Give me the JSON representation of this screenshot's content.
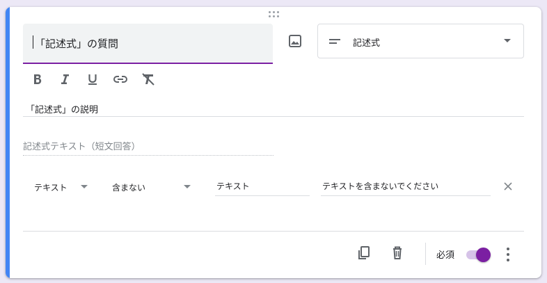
{
  "colors": {
    "accent": "#4285f4",
    "brand_purple": "#7b1fa2",
    "toggle_thumb": "#7b1fa2"
  },
  "question": {
    "title": "「記述式」の質問",
    "description": "「記述式」の説明",
    "answer_hint": "記述式テキスト（短文回答）",
    "type_label": "記述式"
  },
  "formatting": {
    "icons": [
      "bold-icon",
      "italic-icon",
      "underline-icon",
      "link-icon",
      "clear-format-icon"
    ]
  },
  "validation": {
    "type": "テキスト",
    "condition": "含まない",
    "value": "テキスト",
    "error_message": "テキストを含まないでください"
  },
  "footer": {
    "required_label": "必須",
    "required": true
  }
}
